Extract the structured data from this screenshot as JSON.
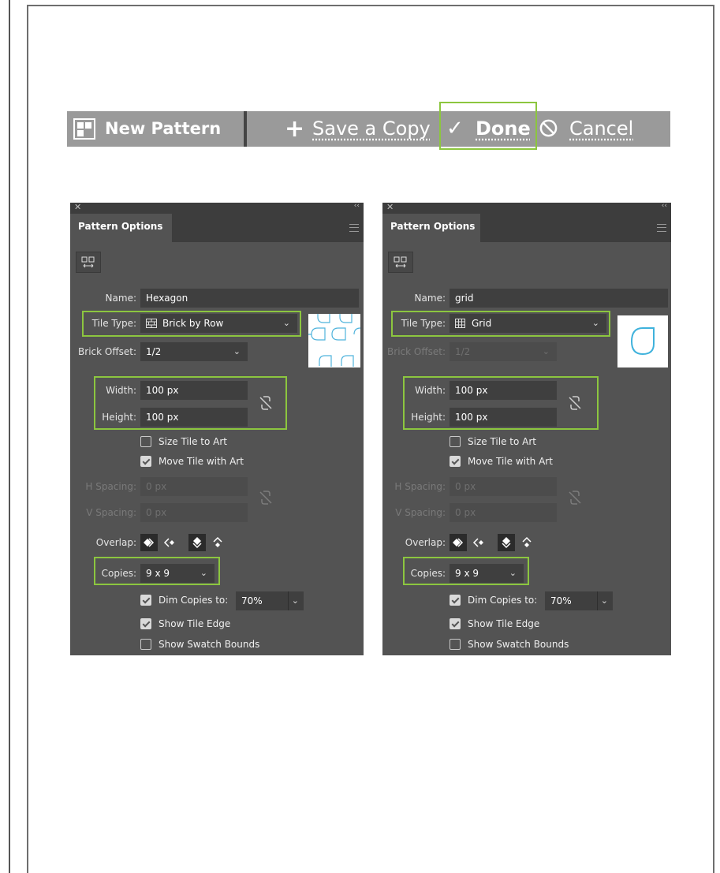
{
  "toolbar": {
    "new_pattern_label": "New Pattern",
    "save_copy_label": "Save a Copy",
    "done_label": "Done",
    "cancel_label": "Cancel",
    "highlight_color": "#8cc63f"
  },
  "panels": [
    {
      "tab_title": "Pattern Options",
      "name_label": "Name:",
      "name_value": "Hexagon",
      "tile_type_label": "Tile Type:",
      "tile_type_value": "Brick by Row",
      "tile_type_icon": "brick-by-row-icon",
      "brick_offset_label": "Brick Offset:",
      "brick_offset_value": "1/2",
      "brick_offset_enabled": true,
      "width_label": "Width:",
      "width_value": "100 px",
      "height_label": "Height:",
      "height_value": "100 px",
      "size_tile_to_art_label": "Size Tile to Art",
      "size_tile_to_art": false,
      "move_tile_with_art_label": "Move Tile with Art",
      "move_tile_with_art": true,
      "h_spacing_label": "H Spacing:",
      "h_spacing_value": "0 px",
      "v_spacing_label": "V Spacing:",
      "v_spacing_value": "0 px",
      "overlap_label": "Overlap:",
      "copies_label": "Copies:",
      "copies_value": "9 x 9",
      "dim_copies_label": "Dim Copies to:",
      "dim_copies": true,
      "dim_copies_value": "70%",
      "show_tile_edge_label": "Show Tile Edge",
      "show_tile_edge": true,
      "show_swatch_bounds_label": "Show Swatch Bounds",
      "show_swatch_bounds": false
    },
    {
      "tab_title": "Pattern Options",
      "name_label": "Name:",
      "name_value": "grid",
      "tile_type_label": "Tile Type:",
      "tile_type_value": "Grid",
      "tile_type_icon": "grid-icon",
      "brick_offset_label": "Brick Offset:",
      "brick_offset_value": "1/2",
      "brick_offset_enabled": false,
      "width_label": "Width:",
      "width_value": "100 px",
      "height_label": "Height:",
      "height_value": "100 px",
      "size_tile_to_art_label": "Size Tile to Art",
      "size_tile_to_art": false,
      "move_tile_with_art_label": "Move Tile with Art",
      "move_tile_with_art": true,
      "h_spacing_label": "H Spacing:",
      "h_spacing_value": "0 px",
      "v_spacing_label": "V Spacing:",
      "v_spacing_value": "0 px",
      "overlap_label": "Overlap:",
      "copies_label": "Copies:",
      "copies_value": "9 x 9",
      "dim_copies_label": "Dim Copies to:",
      "dim_copies": true,
      "dim_copies_value": "70%",
      "show_tile_edge_label": "Show Tile Edge",
      "show_tile_edge": true,
      "show_swatch_bounds_label": "Show Swatch Bounds",
      "show_swatch_bounds": false
    }
  ]
}
